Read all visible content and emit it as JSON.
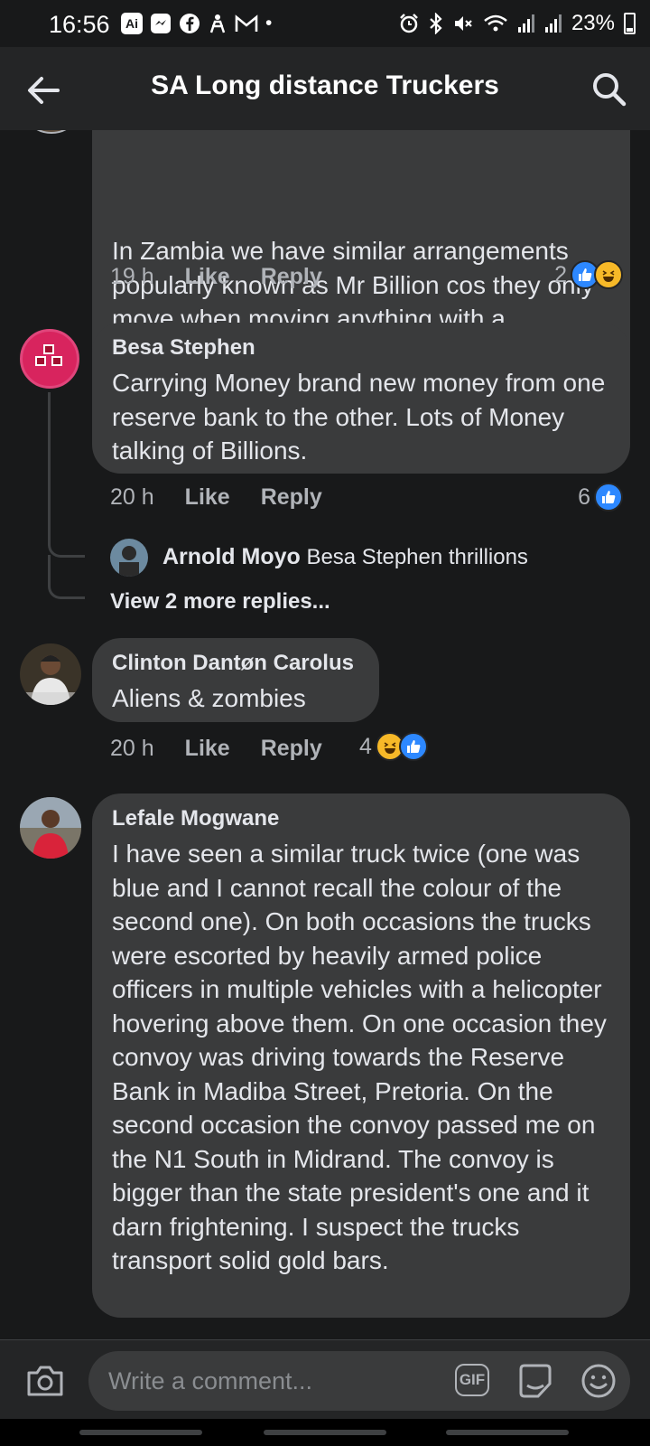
{
  "status_bar": {
    "time": "16:56",
    "battery": "23%",
    "app_icons": [
      "ai-app-icon",
      "messenger-icon",
      "facebook-icon",
      "bixby-icon",
      "gmail-icon",
      "dot-icon"
    ],
    "system_icons": [
      "alarm-icon",
      "bluetooth-icon",
      "mute-icon",
      "wifi-icon",
      "signal-icon",
      "signal-icon",
      "battery-icon"
    ]
  },
  "header": {
    "title": "SA Long distance Truckers",
    "back_icon": "arrow-left-icon",
    "search_icon": "search-icon"
  },
  "comments": [
    {
      "text": "In Zambia we have similar arrangements popularly known as Mr Billion cos they only move when moving anything with a minimum value of a Billion.",
      "time": "19 h",
      "like_label": "Like",
      "reply_label": "Reply",
      "reaction_count": "2",
      "reactions": [
        "like",
        "haha"
      ]
    },
    {
      "author": "Besa Stephen",
      "text": "Carrying Money brand new money from one reserve bank to the other. Lots of Money talking of Billions.",
      "time": "20 h",
      "like_label": "Like",
      "reply_label": "Reply",
      "reaction_count": "6",
      "reactions": [
        "like"
      ],
      "reply_preview": {
        "author": "Arnold Moyo",
        "text": "Besa Stephen thrillions"
      },
      "more_replies": "View 2 more replies..."
    },
    {
      "author": "Clinton Dantøn Carolus",
      "text": "Aliens & zombies",
      "time": "20 h",
      "like_label": "Like",
      "reply_label": "Reply",
      "reaction_count": "4",
      "reactions": [
        "haha",
        "like"
      ]
    },
    {
      "author": "Lefale Mogwane",
      "text": "I have seen a similar truck twice (one was blue and I cannot recall the colour of the second one). On both occasions the trucks were escorted by heavily armed police officers in multiple vehicles with a helicopter hovering above them. On one occasion they convoy was driving towards the Reserve Bank in Madiba Street, Pretoria. On the second occasion the convoy passed me on the N1 South in Midrand. The convoy is bigger than the state president's one and it darn frightening. I suspect the trucks transport solid gold bars."
    }
  ],
  "composer": {
    "placeholder": "Write a comment...",
    "gif_label": "GIF"
  },
  "colors": {
    "background": "#18191a",
    "bubble": "#3a3b3c",
    "like_blue": "#2d88ff",
    "haha_yellow": "#f7b928",
    "secondary_text": "#b0b3b8"
  }
}
